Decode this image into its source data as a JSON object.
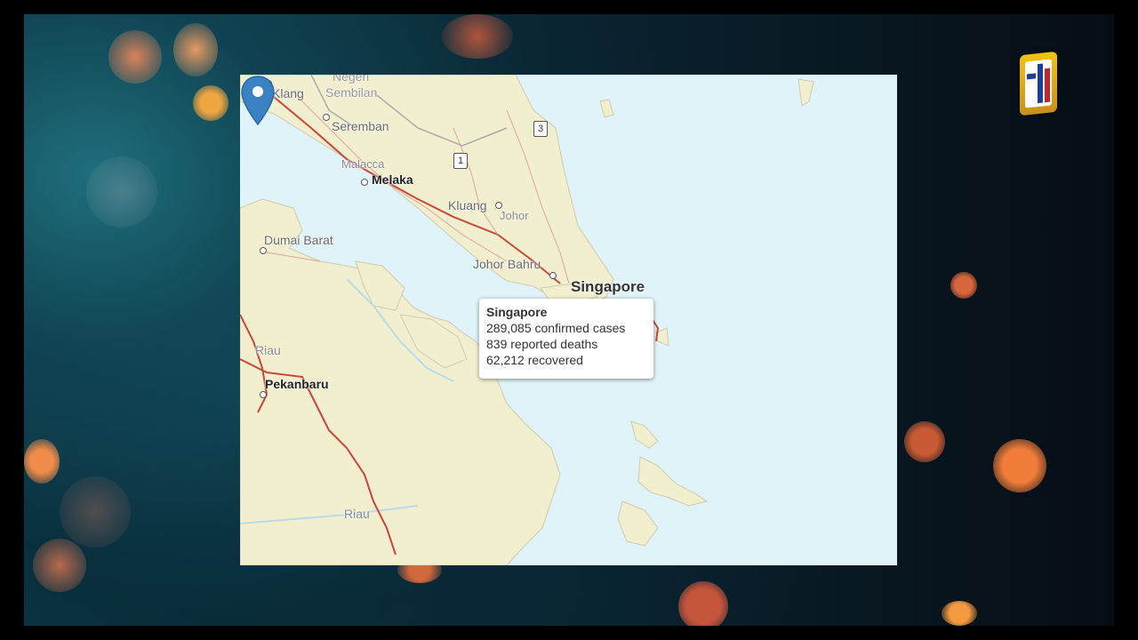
{
  "map": {
    "places": {
      "klang": "Klang",
      "negeri": "Negeri",
      "sembilan": "Sembilan",
      "seremban": "Seremban",
      "malacca": "Malacca",
      "melaka": "Melaka",
      "kluang": "Kluang",
      "johor": "Johor",
      "johor_bahru": "Johor Bahru",
      "singapore": "Singapore",
      "dumai_barat": "Dumai Barat",
      "riau_1": "Riau",
      "pekanbaru": "Pekanbaru",
      "riau_2": "Riau"
    },
    "shields": {
      "s1": "1",
      "s3": "3"
    },
    "marker_icon": "map-pin-icon",
    "colors": {
      "water": "#e0f3f8",
      "land": "#f2efcf",
      "road": "#c9473c",
      "pin": "#3a82c4"
    }
  },
  "popup": {
    "title": "Singapore",
    "confirmed": "289,085 confirmed cases",
    "deaths": "839 reported deaths",
    "recovered": "62,212 recovered"
  },
  "channel_logo": "channel-logo-icon"
}
